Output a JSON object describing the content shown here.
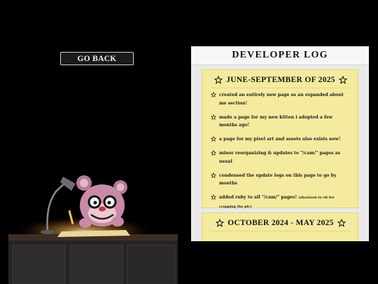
{
  "nav": {
    "go_back_label": "GO BACK"
  },
  "log": {
    "title": "DEVELOPER LOG",
    "sections": [
      {
        "heading": "JUNE-SEPTEMBER OF 2025",
        "entries": [
          {
            "text": "created an entirely new page as an expanded about me section!",
            "note": ""
          },
          {
            "text": "made a page for my new kitten i adopted a few months ago!",
            "note": ""
          },
          {
            "text": "a page for my pixel art and assets also exists now!",
            "note": ""
          },
          {
            "text": "minor reorganizing & updates to \"/cam/\" pages as usual",
            "note": ""
          },
          {
            "text": "condensed the update logs on this page to go by months",
            "note": ""
          },
          {
            "text": "added ruby to all \"/cam/\" pages!",
            "note": "(shoutout to vit for cropping the pfc)"
          }
        ]
      },
      {
        "heading": "OCTOBER 2024 - MAY 2025",
        "entries": []
      }
    ]
  },
  "colors": {
    "card_bg": "#f5eb9e",
    "panel_bg": "#f3f3f1",
    "background": "#000000"
  }
}
